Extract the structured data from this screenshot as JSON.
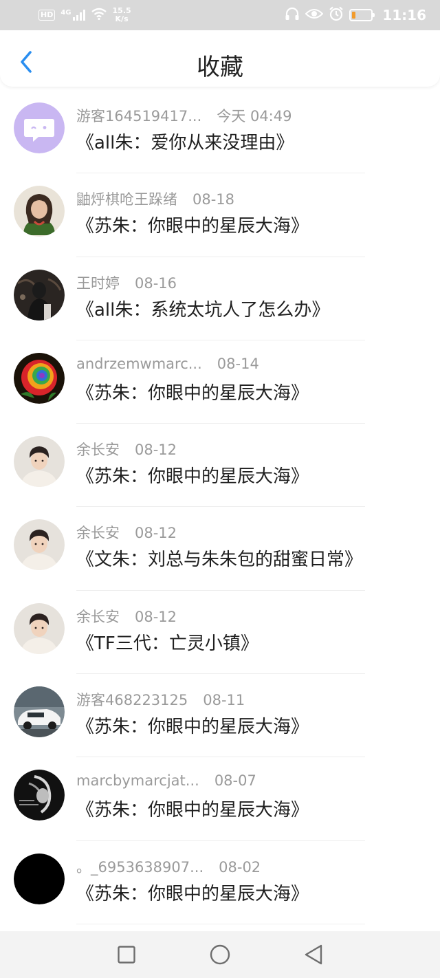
{
  "status_bar": {
    "hd": "HD",
    "signal": "4G",
    "speed_value": "15.5",
    "speed_unit": "K/s",
    "time": "11:16",
    "battery_level": 0.15,
    "icons": [
      "hd-icon",
      "signal-icon",
      "wifi-icon",
      "headphones-icon",
      "eye-icon",
      "alarm-icon",
      "battery-icon"
    ]
  },
  "header": {
    "title": "收藏",
    "back_icon": "chevron-left-icon"
  },
  "items": [
    {
      "user": "游客164519417...",
      "date": "今天 04:49",
      "title": "《all朱：爱你从来没理由》",
      "avatar": "purple-chat-bubble"
    },
    {
      "user": "鼬烀棋呛王跺绪",
      "date": "08-18",
      "title": "《苏朱：你眼中的星辰大海》",
      "avatar": "girl-photo"
    },
    {
      "user": "王时婷",
      "date": "08-16",
      "title": "《all朱：系统太坑人了怎么办》",
      "avatar": "dark-photo"
    },
    {
      "user": "andrzemwmarc...",
      "date": "08-14",
      "title": "《苏朱：你眼中的星辰大海》",
      "avatar": "rainbow-rose"
    },
    {
      "user": "余长安",
      "date": "08-12",
      "title": "《苏朱：你眼中的星辰大海》",
      "avatar": "boy-portrait"
    },
    {
      "user": "余长安",
      "date": "08-12",
      "title": "《文朱：刘总与朱朱包的甜蜜日常》",
      "avatar": "boy-portrait"
    },
    {
      "user": "余长安",
      "date": "08-12",
      "title": "《TF三代：亡灵小镇》",
      "avatar": "boy-portrait"
    },
    {
      "user": "游客468223125",
      "date": "08-11",
      "title": "《苏朱：你眼中的星辰大海》",
      "avatar": "white-car"
    },
    {
      "user": "marcbymarcjat...",
      "date": "08-07",
      "title": "《苏朱：你眼中的星辰大海》",
      "avatar": "bw-portrait"
    },
    {
      "user": "。_6953638907...",
      "date": "08-02",
      "title": "《苏朱：你眼中的星辰大海》",
      "avatar": "black-circle"
    }
  ],
  "colors": {
    "accent": "#2a8ef0",
    "status_bar_bg": "#d9d9d9",
    "meta_text": "#9a9a9a",
    "title_text": "#1f1f1f",
    "nav_bg": "#f3f3f3"
  },
  "nav": {
    "icons": [
      "recent-apps-icon",
      "home-icon",
      "back-icon"
    ]
  }
}
